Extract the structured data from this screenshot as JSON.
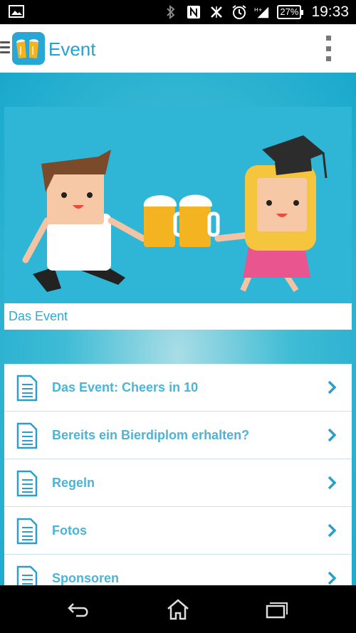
{
  "status_bar": {
    "battery": "27%",
    "time": "19:33",
    "icons": [
      "image-notification-icon",
      "bluetooth-icon",
      "nfc-icon",
      "vibrate-icon",
      "alarm-icon",
      "signal-icon"
    ]
  },
  "app_bar": {
    "title": "Event",
    "accent": "#1fa3d2"
  },
  "hero": {
    "caption": "Das Event"
  },
  "menu": {
    "items": [
      {
        "label": "Das Event: Cheers in 10"
      },
      {
        "label": "Bereits ein Bierdiplom erhalten?"
      },
      {
        "label": "Regeln"
      },
      {
        "label": "Fotos"
      },
      {
        "label": "Sponsoren"
      }
    ]
  },
  "nav_bar": {
    "buttons": [
      "back-icon",
      "home-icon",
      "recent-apps-icon"
    ]
  }
}
